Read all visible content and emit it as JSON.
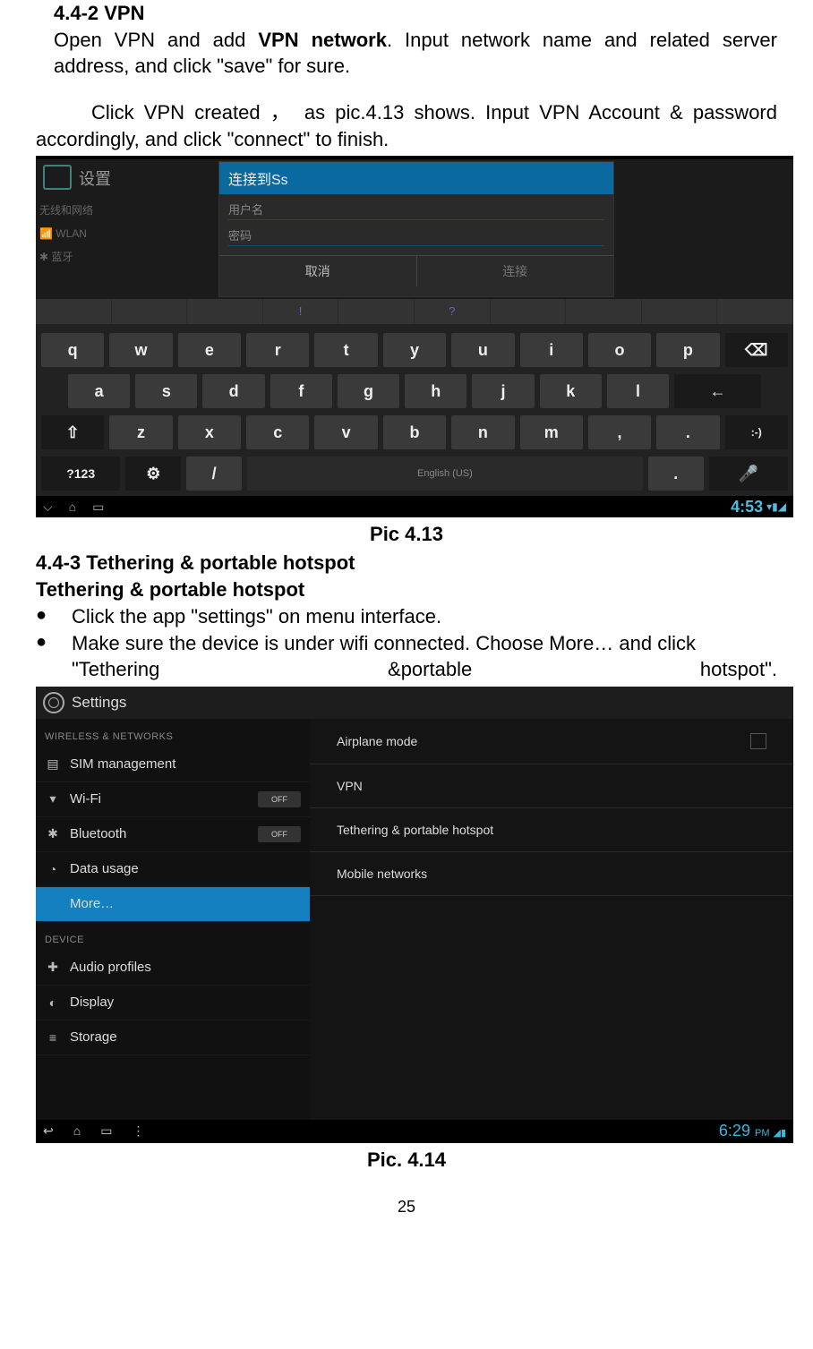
{
  "headings": {
    "h1": "4.4-2 VPN",
    "h2": "4.4-3 Tethering & portable hotspot",
    "h3": "Tethering & portable hotspot"
  },
  "paras": {
    "p1a": "Open VPN and add ",
    "p1b": "VPN network",
    "p1c": ". Input network name and related server address, and click \"save\" for sure.",
    "p2": "Click VPN created ， as pic.4.13 shows. Input VPN Account & password accordingly, and click \"connect\" to finish."
  },
  "captions": {
    "c1": "Pic 4.13",
    "c2": "Pic. 4.14"
  },
  "bullets": {
    "b1": "Click the app \"settings\" on menu interface.",
    "b2a": " Make sure the device is under wifi connected. Choose More… and click",
    "b2_w1": "\"Tethering",
    "b2_w2": "&portable",
    "b2_w3": "hotspot\"."
  },
  "shot1": {
    "title": "设置",
    "dlg_title": "连接到Ss",
    "f1": "用户名",
    "f2": "密码",
    "btn1": "取消",
    "btn2": "连接",
    "side1": "无线和网络",
    "side2": "WLAN",
    "side3": "蓝牙",
    "nums": [
      "",
      "",
      "",
      "!",
      "",
      "?",
      "",
      "",
      "",
      ""
    ],
    "r1": [
      "q",
      "w",
      "e",
      "r",
      "t",
      "y",
      "u",
      "i",
      "o",
      "p"
    ],
    "bksp": "⌫",
    "r2": [
      "a",
      "s",
      "d",
      "f",
      "g",
      "h",
      "j",
      "k",
      "l"
    ],
    "enter": "←",
    "shift": "⇧",
    "r3": [
      "z",
      "x",
      "c",
      "v",
      "b",
      "n",
      "m",
      ",",
      "."
    ],
    "emoji": ":-)",
    "k123": "?123",
    "slash": "/",
    "space": "English (US)",
    "dot": ".",
    "mic": "🎤",
    "nav_back": "⌵",
    "nav_home": "⌂",
    "nav_recent": "▭",
    "clock": "4:53",
    "sig": "▾▮◢"
  },
  "shot2": {
    "hdr": "Settings",
    "cat1": "WIRELESS & NETWORKS",
    "side": [
      {
        "icon": "▤",
        "label": "SIM management"
      },
      {
        "icon": "▾",
        "label": "Wi-Fi",
        "off": "OFF"
      },
      {
        "icon": "✱",
        "label": "Bluetooth",
        "off": "OFF"
      },
      {
        "icon": "◔",
        "label": "Data usage"
      },
      {
        "icon": "",
        "label": "More…",
        "sel": true
      }
    ],
    "cat2": "DEVICE",
    "side2": [
      {
        "icon": "✚",
        "label": "Audio profiles"
      },
      {
        "icon": "◐",
        "label": "Display"
      },
      {
        "icon": "≡",
        "label": "Storage"
      }
    ],
    "main": [
      {
        "label": "Airplane mode",
        "chk": true
      },
      {
        "label": "VPN"
      },
      {
        "label": "Tethering & portable hotspot"
      },
      {
        "label": "Mobile networks"
      }
    ],
    "nav_back": "↩",
    "nav_home": "⌂",
    "nav_recent": "▭",
    "nav_menu": "⋮",
    "clock": "6:29",
    "pm": "PM",
    "sig": "◢▮"
  },
  "page_number": "25"
}
